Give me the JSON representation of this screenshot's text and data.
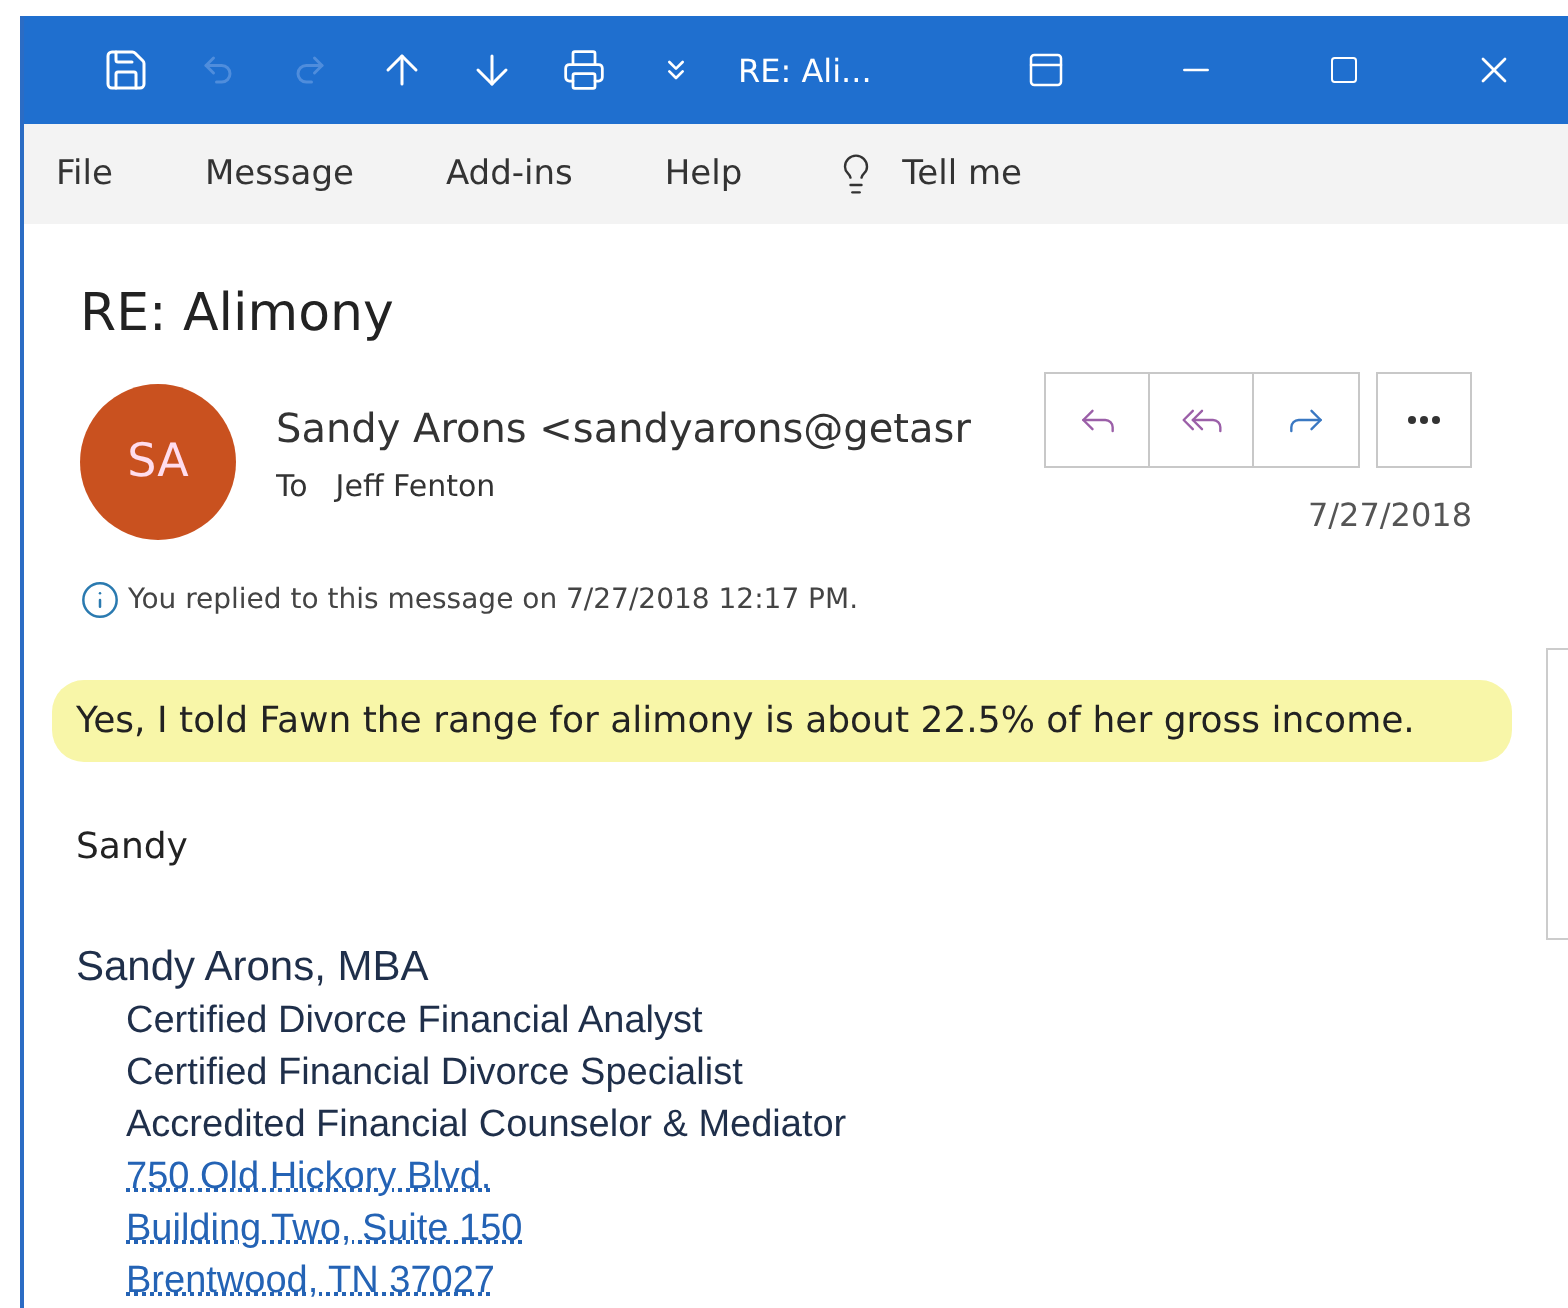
{
  "window": {
    "title": "RE: Ali..."
  },
  "menu": [
    {
      "label": "File"
    },
    {
      "label": "Message"
    },
    {
      "label": "Add-ins"
    },
    {
      "label": "Help"
    }
  ],
  "tell_me": {
    "label": "Tell me"
  },
  "message": {
    "subject": "RE: Alimony",
    "avatar": "SA",
    "sender": "Sandy Arons <sandyarons@getasr",
    "to_label": "To",
    "recipient": "Jeff Fenton",
    "date": "7/27/2018",
    "info": "You replied to this message on 7/27/2018 12:17 PM."
  },
  "body": {
    "highlight": "Yes, I told Fawn the range for alimony is about 22.5% of her gross income.",
    "greeting": "Sandy",
    "signature_name": "Sandy Arons, MBA",
    "signature_lines": [
      {
        "text": "Certified Divorce Financial Analyst",
        "kind": "plain"
      },
      {
        "text": "Certified Financial Divorce Specialist",
        "kind": "plain"
      },
      {
        "text": "Accredited Financial Counselor & Mediator",
        "kind": "plain"
      },
      {
        "text": "750 Old Hickory Blvd.",
        "kind": "link"
      },
      {
        "text": "Building Two, Suite 150",
        "kind": "link"
      },
      {
        "text": "Brentwood, TN  37027",
        "kind": "link"
      }
    ]
  }
}
